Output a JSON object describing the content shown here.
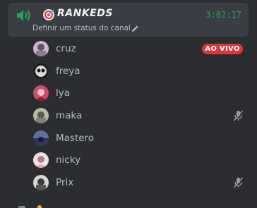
{
  "channel": {
    "emoji_icon": "target-emoji",
    "name": "RANKEDS",
    "timer": "3:02:17",
    "status_placeholder": "Definir um status do canal",
    "speaker_icon": "speaker-active-icon",
    "edit_icon": "pencil-icon"
  },
  "users": [
    {
      "name": "cruz",
      "live": true,
      "muted": false
    },
    {
      "name": "freya",
      "live": false,
      "muted": false
    },
    {
      "name": "lya",
      "live": false,
      "muted": false
    },
    {
      "name": "maka",
      "live": false,
      "muted": true
    },
    {
      "name": "Mastero",
      "live": false,
      "muted": false
    },
    {
      "name": "nicky",
      "live": false,
      "muted": false
    },
    {
      "name": "Prix",
      "live": false,
      "muted": true
    }
  ],
  "live_badge": "AO VIVO",
  "colors": {
    "background": "#2b2d31",
    "card": "#3b3d44",
    "accent_green": "#23a55a",
    "live_red": "#da373c",
    "muted_text": "#b5bac1"
  }
}
